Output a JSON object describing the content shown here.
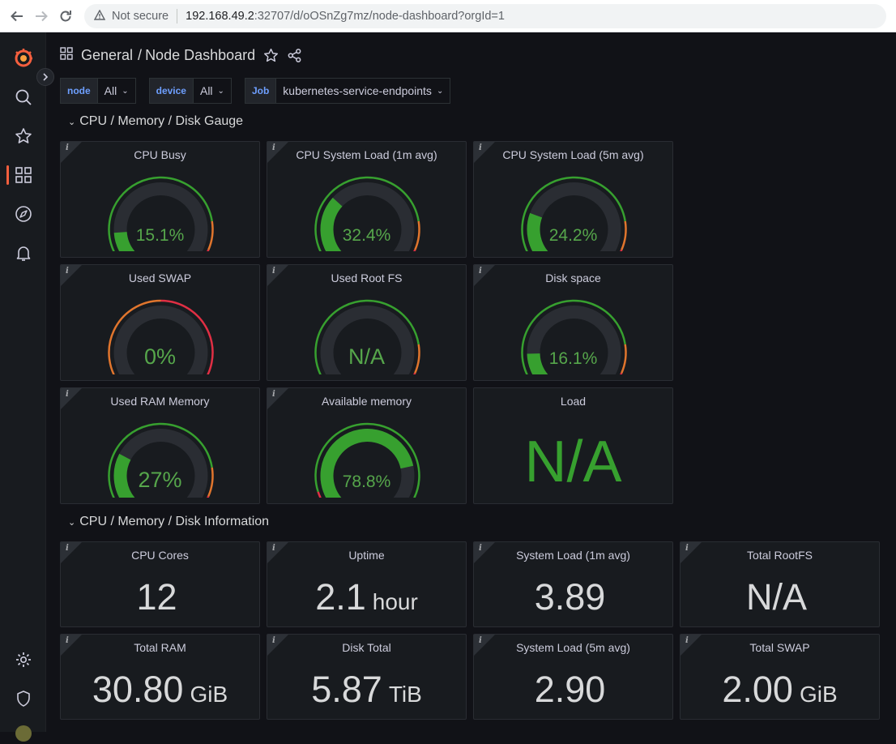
{
  "browser": {
    "security": "Not secure",
    "url_host": "192.168.49.2",
    "url_path": ":32707/d/oOSnZg7mz/node-dashboard?orgId=1"
  },
  "header": {
    "folder": "General",
    "separator": "/",
    "title": "Node Dashboard"
  },
  "variables": [
    {
      "label": "node",
      "value": "All"
    },
    {
      "label": "device",
      "value": "All"
    },
    {
      "label": "Job",
      "value": "kubernetes-service-endpoints"
    }
  ],
  "rows": {
    "gauge_row": "CPU / Memory / Disk Gauge",
    "info_row": "CPU / Memory / Disk Information"
  },
  "gauges": [
    {
      "title": "CPU Busy",
      "value": "15.1%",
      "fraction": 0.151,
      "color": "#37a02f"
    },
    {
      "title": "CPU System Load (1m avg)",
      "value": "32.4%",
      "fraction": 0.324,
      "color": "#37a02f"
    },
    {
      "title": "CPU System Load (5m avg)",
      "value": "24.2%",
      "fraction": 0.242,
      "color": "#37a02f"
    },
    {
      "title": "Used SWAP",
      "value": "0%",
      "fraction": 0.0,
      "color": "#37a02f"
    },
    {
      "title": "Used Root FS",
      "value": "N/A",
      "fraction": 0.0,
      "color": "#37a02f"
    },
    {
      "title": "Disk space",
      "value": "16.1%",
      "fraction": 0.161,
      "color": "#37a02f"
    },
    {
      "title": "Used RAM Memory",
      "value": "27%",
      "fraction": 0.27,
      "color": "#37a02f"
    },
    {
      "title": "Available memory",
      "value": "78.8%",
      "fraction": 0.788,
      "color": "#37a02f"
    }
  ],
  "load_panel": {
    "title": "Load",
    "value": "N/A"
  },
  "stats": [
    {
      "title": "CPU Cores",
      "value": "12",
      "unit": ""
    },
    {
      "title": "Uptime",
      "value": "2.1",
      "unit": "hour"
    },
    {
      "title": "System Load (1m avg)",
      "value": "3.89",
      "unit": ""
    },
    {
      "title": "Total RootFS",
      "value": "N/A",
      "unit": ""
    },
    {
      "title": "Total RAM",
      "value": "30.80",
      "unit": "GiB"
    },
    {
      "title": "Disk Total",
      "value": "5.87",
      "unit": "TiB"
    },
    {
      "title": "System Load (5m avg)",
      "value": "2.90",
      "unit": ""
    },
    {
      "title": "Total SWAP",
      "value": "2.00",
      "unit": "GiB"
    }
  ],
  "colors": {
    "accent": "#f55f3e",
    "ok_green": "#37a02f",
    "background": "#111217",
    "panel": "#181b1f"
  },
  "icons": {
    "sidebar": [
      "grafana-logo-icon",
      "search-icon",
      "star-icon",
      "dashboards-icon",
      "explore-icon",
      "alerting-icon",
      "settings-icon",
      "shield-icon"
    ]
  }
}
